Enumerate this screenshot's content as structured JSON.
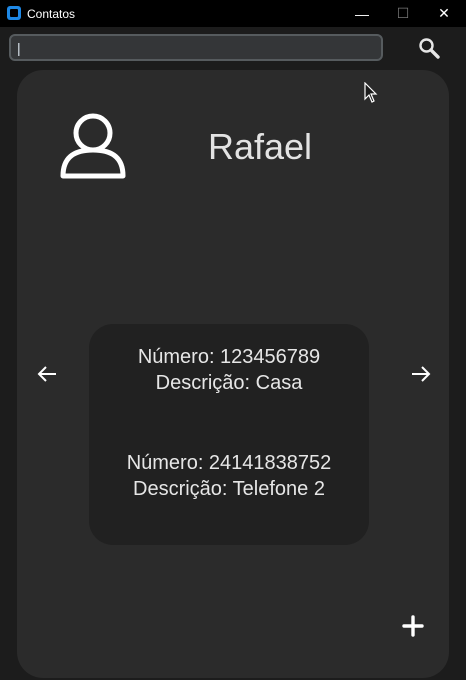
{
  "window": {
    "title": "Contatos",
    "controls": {
      "minimize": "—",
      "maximize": "☐",
      "close": "✕"
    }
  },
  "search": {
    "value": "|",
    "placeholder": ""
  },
  "icons": {
    "search": "search-icon",
    "avatar": "user-icon",
    "prev": "arrow-left-icon",
    "next": "arrow-right-icon",
    "add": "plus-icon"
  },
  "contact": {
    "name": "Rafael",
    "phones": [
      {
        "number_line": "Número: 123456789",
        "description_line": "Descrição: Casa"
      },
      {
        "number_line": "Número: 24141838752",
        "description_line": "Descrição: Telefone 2"
      }
    ]
  },
  "colors": {
    "background": "#1c1c1c",
    "card": "#2b2b2b",
    "panel": "#212121",
    "accent": "#1e88e5",
    "text": "#e6e6e6"
  }
}
